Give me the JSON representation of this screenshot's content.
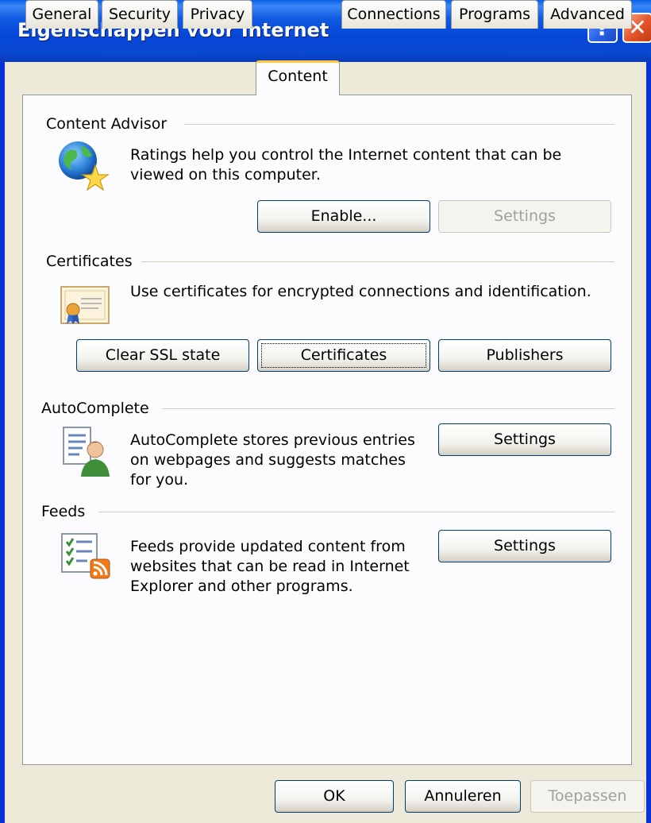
{
  "window": {
    "title": "Eigenschappen voor Internet",
    "help_label": "?",
    "close_label": "✕"
  },
  "tabs": [
    {
      "label": "General"
    },
    {
      "label": "Security"
    },
    {
      "label": "Privacy"
    },
    {
      "label": "Content"
    },
    {
      "label": "Connections"
    },
    {
      "label": "Programs"
    },
    {
      "label": "Advanced"
    }
  ],
  "active_tab": "Content",
  "content_advisor": {
    "title": "Content Advisor",
    "icon": "globe-star-icon",
    "line1": "Ratings help you control the Internet content that can be",
    "line2": "viewed on this computer.",
    "enable_label": "Enable...",
    "settings_label": "Settings"
  },
  "certificates": {
    "title": "Certificates",
    "icon": "certificate-icon",
    "description": "Use certificates for encrypted connections and identification.",
    "clear_ssl_label": "Clear SSL state",
    "certificates_label": "Certificates",
    "publishers_label": "Publishers"
  },
  "autocomplete": {
    "title": "AutoComplete",
    "icon": "autocomplete-user-icon",
    "line1": "AutoComplete stores previous entries",
    "line2": "on webpages and suggests matches",
    "line3": "for you.",
    "settings_label": "Settings"
  },
  "feeds": {
    "title": "Feeds",
    "icon": "feeds-rss-icon",
    "line1": "Feeds provide updated content from",
    "line2": "websites that can be read in Internet",
    "line3": "Explorer and other programs.",
    "settings_label": "Settings"
  },
  "footer": {
    "ok_label": "OK",
    "cancel_label": "Annuleren",
    "apply_label": "Toepassen"
  },
  "colors": {
    "titlebar": "#0a49d2",
    "dialog_bg": "#ece9d8",
    "panel_bg": "#fcfcfe",
    "active_tab_accent": "#ffc83c"
  }
}
